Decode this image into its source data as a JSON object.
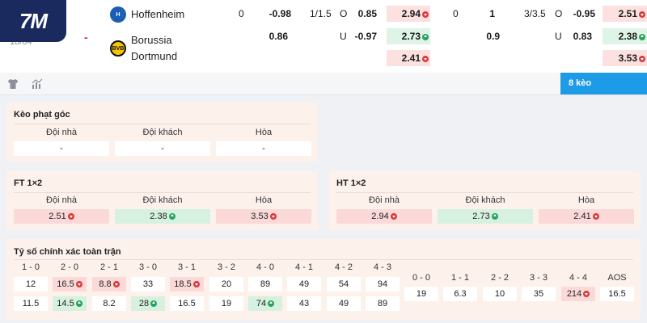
{
  "logo": "7M",
  "match": {
    "date": "18/04",
    "score_dash": "-",
    "home_team": "Hoffenheim",
    "away_team_line1": "Borussia",
    "away_team_line2": "Dortmund",
    "row1": {
      "hdp": "0",
      "hdp_odds": "-0.98",
      "ou_line": "1/1.5",
      "ou_side": "O",
      "ou_odds": "0.85",
      "x12": "2.94",
      "hdp2": "0",
      "hdp2_odds": "1",
      "ou2_line": "3/3.5",
      "ou2_side": "O",
      "ou2_odds": "-0.95",
      "x12_2": "2.51"
    },
    "row2": {
      "hdp_odds": "0.86",
      "ou_side": "U",
      "ou_odds": "-0.97",
      "x12": "2.73",
      "hdp2_odds": "0.9",
      "ou2_side": "U",
      "ou2_odds": "0.83",
      "x12_2": "2.38"
    },
    "row3": {
      "x12": "2.41",
      "x12_2": "3.53"
    }
  },
  "toolbar": {
    "more_label": "8 kèo",
    "icon1": "shirt-icon",
    "icon2": "stats-icon"
  },
  "corners": {
    "title": "Kèo phạt góc",
    "labels": [
      "Đội nhà",
      "Đội khách",
      "Hòa"
    ],
    "values": [
      "-",
      "-",
      "-"
    ]
  },
  "ft": {
    "title": "FT 1×2",
    "labels": [
      "Đội nhà",
      "Đội khách",
      "Hòa"
    ],
    "values": [
      "2.51",
      "2.38",
      "3.53"
    ]
  },
  "ht": {
    "title": "HT 1×2",
    "labels": [
      "Đội nhà",
      "Đội khách",
      "Hòa"
    ],
    "values": [
      "2.94",
      "2.73",
      "2.41"
    ]
  },
  "cs": {
    "title": "Tỷ số chính xác toàn trận",
    "left_headers": [
      "1 - 0",
      "2 - 0",
      "2 - 1",
      "3 - 0",
      "3 - 1",
      "3 - 2",
      "4 - 0",
      "4 - 1",
      "4 - 2",
      "4 - 3"
    ],
    "left_row1": [
      "12",
      "16.5",
      "8.8",
      "33",
      "18.5",
      "20",
      "89",
      "49",
      "54",
      "94"
    ],
    "left_row2": [
      "11.5",
      "14.5",
      "8.2",
      "28",
      "16.5",
      "19",
      "74",
      "43",
      "49",
      "89"
    ],
    "right_headers": [
      "0 - 0",
      "1 - 1",
      "2 - 2",
      "3 - 3",
      "4 - 4",
      "AOS"
    ],
    "right_values": [
      "19",
      "6.3",
      "10",
      "35",
      "214",
      "16.5"
    ]
  }
}
